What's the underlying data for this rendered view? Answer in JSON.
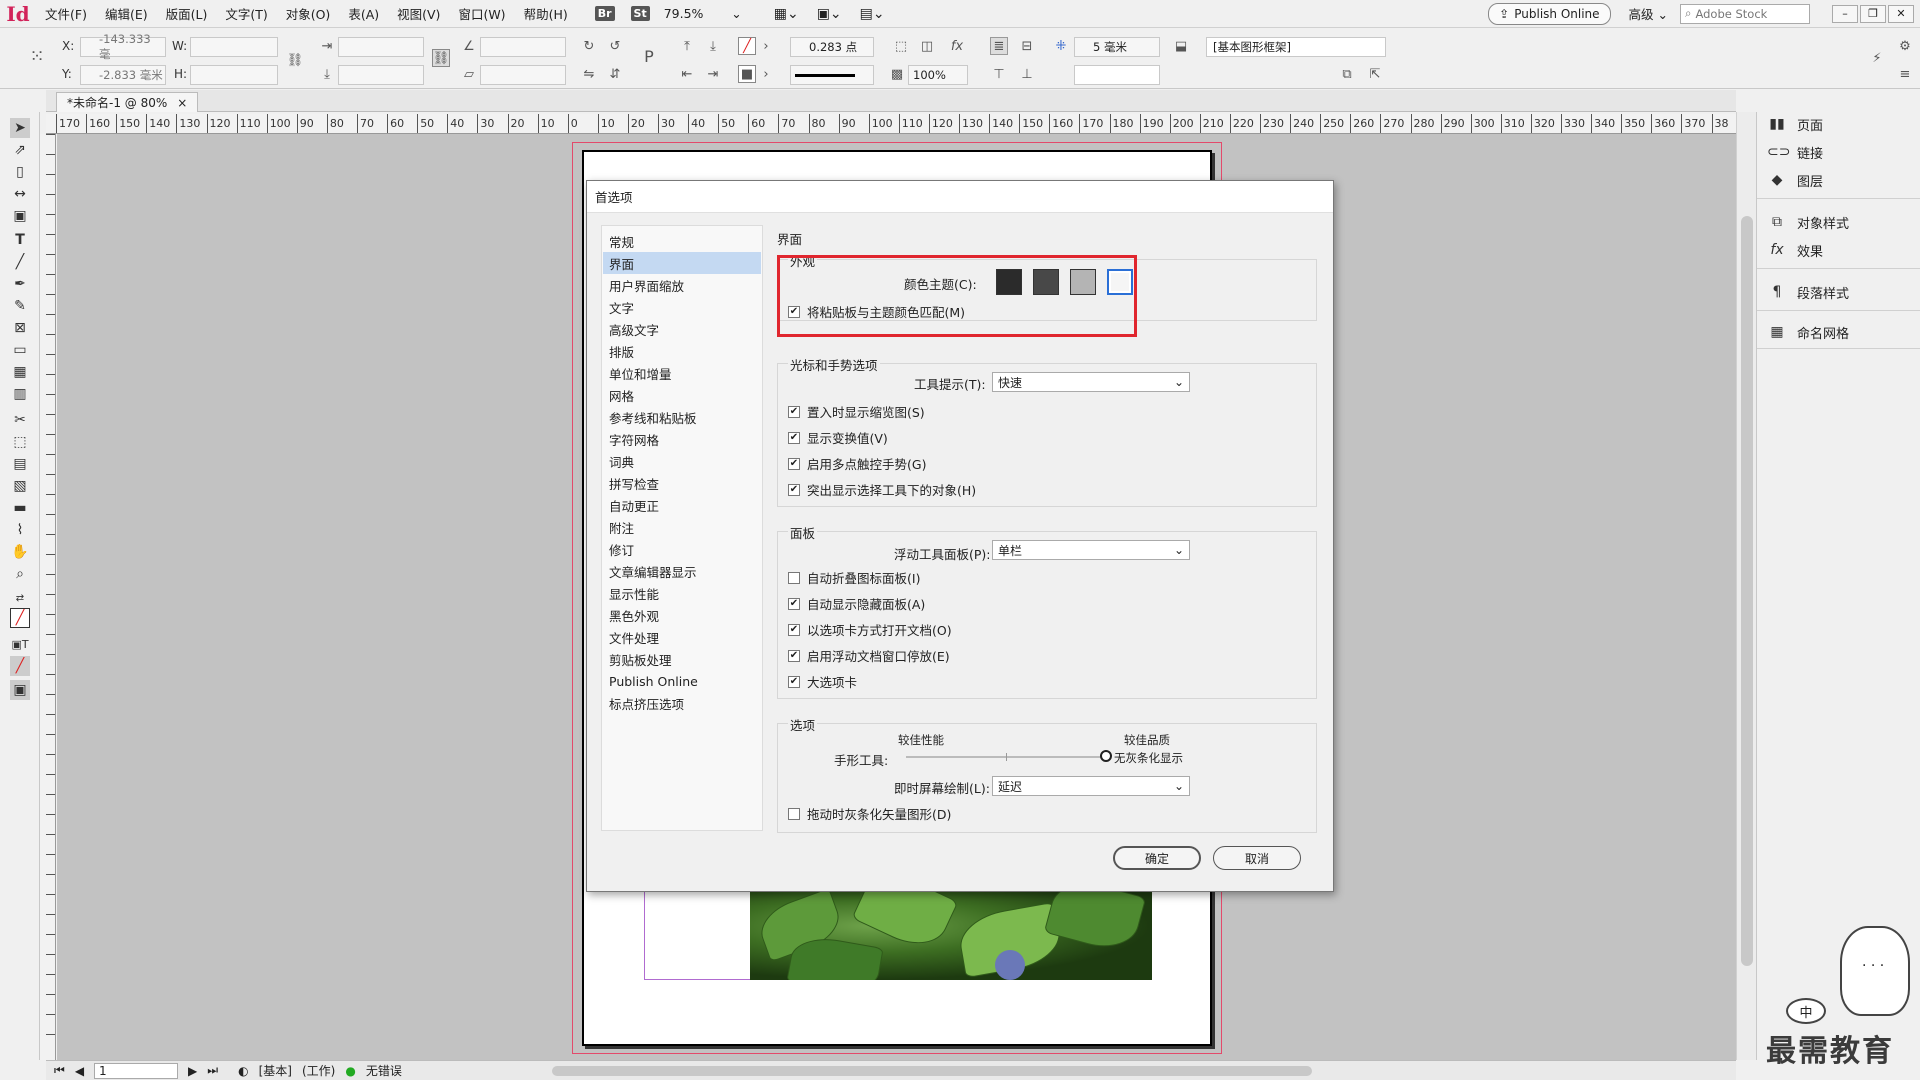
{
  "app": {
    "logo": "Id"
  },
  "menubar": {
    "items": [
      "文件(F)",
      "编辑(E)",
      "版面(L)",
      "文字(T)",
      "对象(O)",
      "表(A)",
      "视图(V)",
      "窗口(W)",
      "帮助(H)"
    ],
    "badges": [
      "Br",
      "St"
    ],
    "zoom": "79.5%",
    "publish": "Publish Online",
    "workspace": "高级",
    "search_placeholder": "Adobe Stock"
  },
  "control": {
    "x_label": "X:",
    "x_value": "-143.333 毫",
    "y_label": "Y:",
    "y_value": "-2.833 毫米",
    "w_label": "W:",
    "h_label": "H:",
    "stroke_weight": "0.283 点",
    "opacity": "100%",
    "offset": "5 毫米",
    "object_style": "[基本图形框架]"
  },
  "document": {
    "tab_title": "*未命名-1 @ 80%",
    "close": "×"
  },
  "ruler": {
    "ticks": [
      "170",
      "160",
      "150",
      "140",
      "130",
      "120",
      "110",
      "100",
      "90",
      "80",
      "70",
      "60",
      "50",
      "40",
      "30",
      "20",
      "10",
      "0",
      "10",
      "20",
      "30",
      "40",
      "50",
      "60",
      "70",
      "80",
      "90",
      "100",
      "110",
      "120",
      "130",
      "140",
      "150",
      "160",
      "170",
      "180",
      "190",
      "200",
      "210",
      "220",
      "230",
      "240",
      "250",
      "260",
      "270",
      "280",
      "290",
      "300",
      "310",
      "320",
      "330",
      "340",
      "350",
      "360",
      "370",
      "38"
    ]
  },
  "status": {
    "page": "1",
    "master": "[基本]",
    "mode": "(工作)",
    "errors": "无错误"
  },
  "panels": [
    {
      "label": "页面",
      "icon": "pages-icon"
    },
    {
      "label": "链接",
      "icon": "links-icon"
    },
    {
      "label": "图层",
      "icon": "layers-icon"
    },
    {
      "label": "对象样式",
      "icon": "object-styles-icon"
    },
    {
      "label": "效果",
      "icon": "effects-icon"
    },
    {
      "label": "段落样式",
      "icon": "paragraph-styles-icon"
    },
    {
      "label": "命名网格",
      "icon": "named-grids-icon"
    }
  ],
  "dialog": {
    "title": "首选项",
    "nav": [
      "常规",
      "界面",
      "用户界面缩放",
      "文字",
      "高级文字",
      "排版",
      "单位和增量",
      "网格",
      "参考线和粘贴板",
      "字符网格",
      "词典",
      "拼写检查",
      "自动更正",
      "附注",
      "修订",
      "文章编辑器显示",
      "显示性能",
      "黑色外观",
      "文件处理",
      "剪贴板处理",
      "Publish Online",
      "标点挤压选项"
    ],
    "selected_nav": "界面",
    "page_heading": "界面",
    "appearance": {
      "title": "外观",
      "theme_label": "颜色主题(C):",
      "theme_colors": [
        "#2b2b2b",
        "#484848",
        "#b4b4b4",
        "#f5f5f5"
      ],
      "match_pasteboard": "将粘贴板与主题颜色匹配(M)"
    },
    "cursor": {
      "title": "光标和手势选项",
      "tooltip_label": "工具提示(T):",
      "tooltip_value": "快速",
      "options": [
        "置入时显示缩览图(S)",
        "显示变换值(V)",
        "启用多点触控手势(G)",
        "突出显示选择工具下的对象(H)"
      ]
    },
    "panel_sec": {
      "title": "面板",
      "floating_label": "浮动工具面板(P):",
      "floating_value": "单栏",
      "options": [
        {
          "label": "自动折叠图标面板(I)",
          "checked": false
        },
        {
          "label": "自动显示隐藏面板(A)",
          "checked": true
        },
        {
          "label": "以选项卡方式打开文档(O)",
          "checked": true
        },
        {
          "label": "启用浮动文档窗口停放(E)",
          "checked": true
        },
        {
          "label": "大选项卡",
          "checked": true
        }
      ]
    },
    "options_sec": {
      "title": "选项",
      "perf_label": "较佳性能",
      "quality_label": "较佳品质",
      "hand_label": "手形工具:",
      "hand_value_text": "无灰条化显示",
      "hand_level": 1.0,
      "live_label": "即时屏幕绘制(L):",
      "live_value": "延迟",
      "greek_vector": "拖动时灰条化矢量图形(D)"
    },
    "ok": "确定",
    "cancel": "取消"
  },
  "watermark": {
    "text": "最需教育",
    "bubble": "中"
  }
}
